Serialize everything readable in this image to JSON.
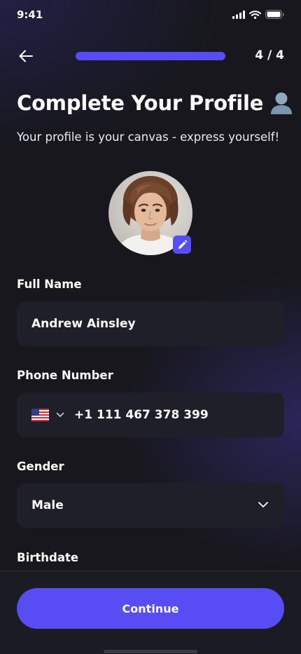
{
  "status_bar": {
    "time": "9:41"
  },
  "header": {
    "step": "4 / 4",
    "progress": 1.0
  },
  "title": "Complete Your Profile",
  "title_emoji": "👤",
  "subtitle": "Your profile is your canvas - express yourself!",
  "form": {
    "full_name": {
      "label": "Full Name",
      "value": "Andrew Ainsley"
    },
    "phone": {
      "label": "Phone Number",
      "country": "US",
      "value": "+1 111 467 378 399"
    },
    "gender": {
      "label": "Gender",
      "value": "Male"
    },
    "birthdate": {
      "label": "Birthdate"
    }
  },
  "continue_label": "Continue",
  "colors": {
    "accent": "#584CF4",
    "field_bg": "#1F1F29",
    "background": "#17171D"
  }
}
